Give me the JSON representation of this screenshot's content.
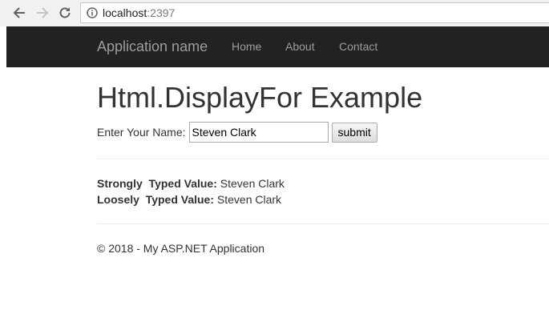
{
  "browser": {
    "url_host": "localhost",
    "url_port": ":2397"
  },
  "navbar": {
    "brand": "Application name",
    "links": [
      "Home",
      "About",
      "Contact"
    ]
  },
  "main": {
    "title": "Html.DisplayFor Example",
    "name_label": "Enter Your Name:",
    "name_value": "Steven Clark",
    "submit_label": "submit",
    "strong_label": "Strongly  Typed Value:",
    "strong_value": " Steven Clark",
    "loose_label": "Loosely  Typed Value:",
    "loose_value": " Steven Clark"
  },
  "footer": {
    "text": "© 2018 - My ASP.NET Application"
  },
  "colors": {
    "navbar_bg": "#222222",
    "navbar_text": "#9d9d9d",
    "body_text": "#333333"
  }
}
